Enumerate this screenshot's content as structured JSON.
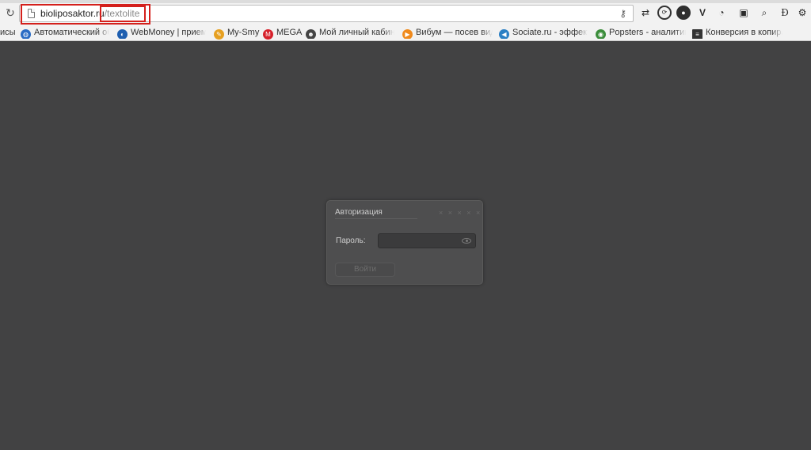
{
  "browser": {
    "url_host": "bioliposaktor.ru",
    "url_path": "/textolite",
    "reload_icon": "reload-icon",
    "key_icon": "key-icon",
    "extensions": [
      {
        "name": "network-extension-icon",
        "glyph": "⇄"
      },
      {
        "name": "refresh-extension-icon",
        "glyph": "⟳"
      },
      {
        "name": "dark-circle-extension-icon",
        "glyph": "●"
      },
      {
        "name": "v-extension-icon",
        "glyph": "V"
      },
      {
        "name": "speed-extension-icon",
        "glyph": "◔"
      },
      {
        "name": "bag-extension-icon",
        "glyph": "▣"
      },
      {
        "name": "search-extension-icon",
        "glyph": "⌕"
      },
      {
        "name": "d-extension-icon",
        "glyph": "Ɖ"
      },
      {
        "name": "settings-extension-icon",
        "glyph": "⚙"
      }
    ],
    "bookmarks": [
      {
        "label": "исы",
        "icon": "none",
        "color": "#f2f2f2"
      },
      {
        "label": "Автоматический обм",
        "icon": "globe-icon",
        "color": "#2a6cc4"
      },
      {
        "label": "WebMoney | прием п",
        "icon": "webmoney-icon",
        "color": "#1f5fb0"
      },
      {
        "label": "My-Smy",
        "icon": "pencil-icon",
        "color": "#e6a021"
      },
      {
        "label": "MEGA",
        "icon": "mega-icon",
        "color": "#d6202a"
      },
      {
        "label": "Мой личный кабинет",
        "icon": "person-icon",
        "color": "#444444"
      },
      {
        "label": "Вибум — посев виде",
        "icon": "play-icon",
        "color": "#f08a1c"
      },
      {
        "label": "Sociate.ru - эффекти",
        "icon": "megaphone-icon",
        "color": "#2a7fc4"
      },
      {
        "label": "Popsters - аналитика",
        "icon": "chrome-icon",
        "color": "#3b8d3b"
      },
      {
        "label": "Конверсия в копира",
        "icon": "doc-icon",
        "color": "#333333"
      }
    ]
  },
  "dialog": {
    "title": "Авторизация",
    "close_marks": "× × × × ×",
    "password_label": "Пароль:",
    "password_value": "",
    "show_password_icon": "eye-icon",
    "login_button": "Войти"
  }
}
